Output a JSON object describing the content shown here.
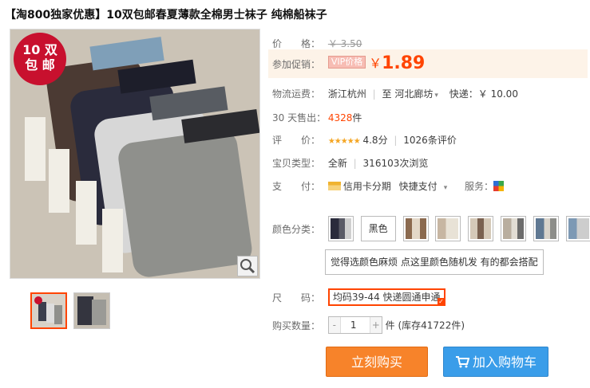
{
  "title": "【淘800独家优惠】10双包邮春夏薄款全棉男士袜子 纯棉船袜子",
  "badge": {
    "line1": "10 双",
    "line2": "包 邮"
  },
  "price": {
    "label": "价　　格：",
    "original": "￥ 3.50"
  },
  "promo": {
    "label": "参加促销：",
    "vip": "VIP价格",
    "currency": "￥",
    "value": "1.89"
  },
  "shipping": {
    "label": "物流运费：",
    "from": "浙江杭州",
    "to_word": "至",
    "to": "河北廊坊",
    "express_label": "快递：",
    "express": "￥ 10.00"
  },
  "sales": {
    "label": "30 天售出：",
    "count": "4328",
    "unit": "件"
  },
  "rating": {
    "label": "评　　价：",
    "stars": "★★★★★",
    "score": "4.8分",
    "reviews": "1026条评价"
  },
  "condition": {
    "label": "宝贝类型：",
    "value": "全新",
    "views": "316103次浏览"
  },
  "payment": {
    "label": "支　　付：",
    "installment": "信用卡分期",
    "quickpay": "快捷支付",
    "service_label": "服务："
  },
  "color": {
    "label": "颜色分类：",
    "text_option": "黑色",
    "long_option": "觉得选颜色麻烦 点这里颜色随机发 有的都会搭配"
  },
  "size": {
    "label": "尺　　码：",
    "selected": "均码39-44 快递圆通申通"
  },
  "quantity": {
    "label": "购买数量：",
    "minus": "-",
    "value": "1",
    "plus": "+",
    "stock": "件 (库存41722件)"
  },
  "buttons": {
    "buy": "立刻购买",
    "cart": "加入购物车"
  },
  "colors": {
    "accent": "#ff4400",
    "buy": "#f7832a",
    "cart": "#3a9de9",
    "badge": "#c8102e"
  }
}
